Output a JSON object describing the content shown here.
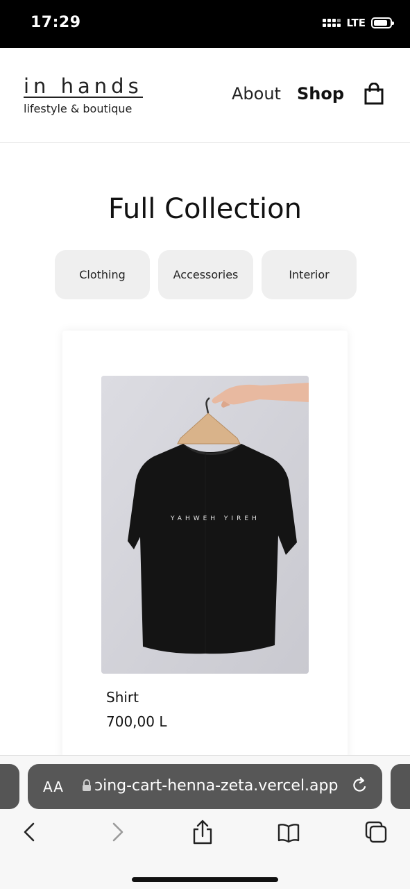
{
  "status_bar": {
    "time": "17:29",
    "network": "LTE",
    "signal_icon": "signal-bars-icon",
    "battery_icon": "battery-icon",
    "battery_level": 0.85
  },
  "header": {
    "logo_title": "in hands",
    "logo_subtitle": "lifestyle & boutique",
    "nav": {
      "about": "About",
      "shop": "Shop"
    },
    "cart_icon": "shopping-bag-icon"
  },
  "main": {
    "title": "Full Collection",
    "filters": [
      "Clothing",
      "Accessories",
      "Interior"
    ],
    "products": [
      {
        "name": "Shirt",
        "price": "700,00 L",
        "image_icon": "black-tshirt-on-hanger-image",
        "shirt_print": "YAHWEH YIREH"
      }
    ]
  },
  "browser": {
    "text_size_label": "AA",
    "url": "ɔing-cart-henna-zeta.vercel.app",
    "lock_icon": "lock-icon",
    "reload_icon": "reload-icon",
    "toolbar_icons": [
      "back-icon",
      "forward-icon",
      "share-icon",
      "bookmarks-icon",
      "tabs-icon"
    ]
  }
}
